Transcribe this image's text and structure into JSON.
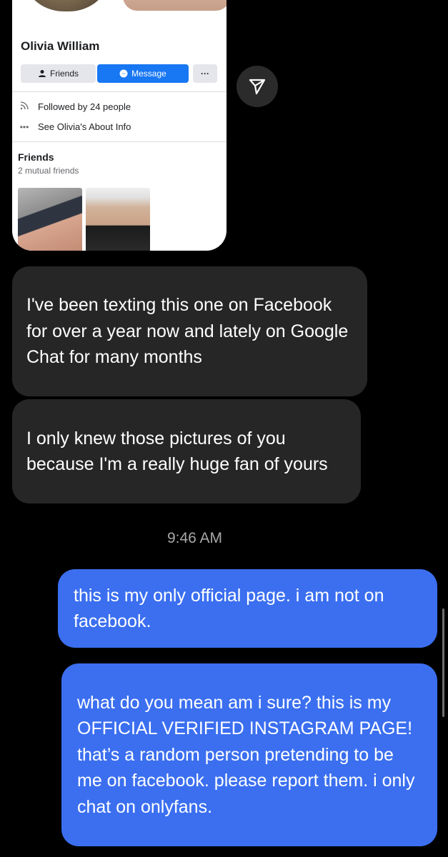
{
  "profile_card": {
    "name": "Olivia William",
    "friends_button": "Friends",
    "message_button": "Message",
    "more_button": "···",
    "followed_by": "Followed by 24 people",
    "about_info": "See Olivia's About Info",
    "friends_title": "Friends",
    "mutual_friends": "2 mutual friends"
  },
  "messages": [
    {
      "sender": "them",
      "text": "I've been texting this one on Facebook for over a year now and lately on Google Chat for many months"
    },
    {
      "sender": "them",
      "text": "I only knew those pictures of you because I'm a really huge fan of yours"
    },
    {
      "sender": "me",
      "text": "this is my only official page. i am not on facebook."
    },
    {
      "sender": "me",
      "text": "what do you mean am i sure? this is my OFFICIAL VERIFIED INSTAGRAM PAGE! that’s a random person pretending to be me on facebook. please report them. i only chat on onlyfans."
    }
  ],
  "timestamp": "9:46 AM",
  "colors": {
    "incoming_bubble": "#262626",
    "outgoing_bubble": "#3b6ff0",
    "facebook_blue": "#1877f2"
  }
}
